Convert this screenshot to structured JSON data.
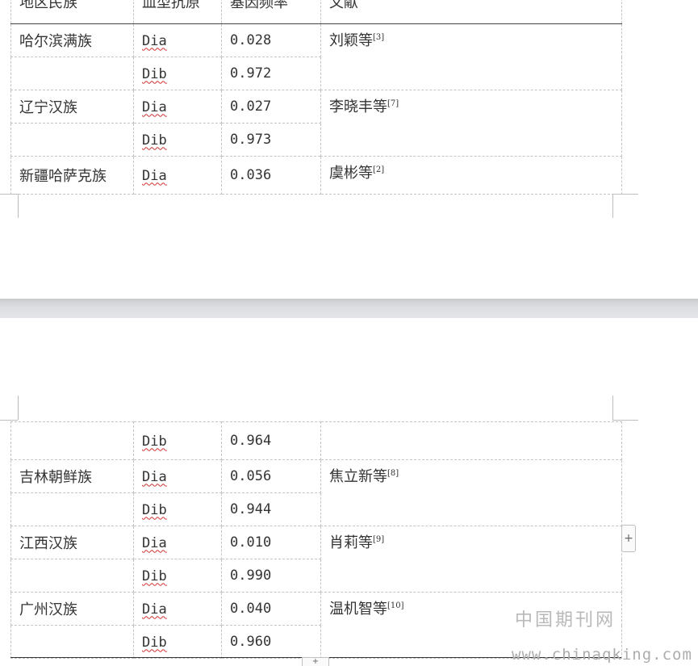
{
  "table": {
    "headers": [
      "地区民族",
      "血型抗原",
      "基因频率",
      "文献"
    ],
    "page1_rows": [
      {
        "region": "哈尔滨满族",
        "antigen": "Dia",
        "freq": "0.028",
        "ref": "刘颖等",
        "ref_sup": "[3]"
      },
      {
        "region": "",
        "antigen": "Dib",
        "freq": "0.972"
      },
      {
        "region": "辽宁汉族",
        "antigen": "Dia",
        "freq": "0.027",
        "ref": "李晓丰等",
        "ref_sup": "[7]"
      },
      {
        "region": "",
        "antigen": "Dib",
        "freq": "0.973"
      },
      {
        "region": "新疆哈萨克族",
        "antigen": "Dia",
        "freq": "0.036",
        "ref": "虞彬等",
        "ref_sup": "[2]"
      }
    ],
    "page2_rows": [
      {
        "region": "",
        "antigen": "Dib",
        "freq": "0.964"
      },
      {
        "region": "吉林朝鲜族",
        "antigen": "Dia",
        "freq": "0.056",
        "ref": "焦立新等",
        "ref_sup": "[8]"
      },
      {
        "region": "",
        "antigen": "Dib",
        "freq": "0.944"
      },
      {
        "region": "江西汉族",
        "antigen": "Dia",
        "freq": "0.010",
        "ref": "肖莉等",
        "ref_sup": "[9]"
      },
      {
        "region": "",
        "antigen": "Dib",
        "freq": "0.990"
      },
      {
        "region": "广州汉族",
        "antigen": "Dia",
        "freq": "0.040",
        "ref": "温机智等",
        "ref_sup": "[10]"
      },
      {
        "region": "",
        "antigen": "Dib",
        "freq": "0.960"
      }
    ]
  },
  "controls": {
    "add_row": "+",
    "add_col": "+"
  },
  "watermark": {
    "line1": "中国期刊网",
    "line2": "www.chinaqking.com"
  }
}
